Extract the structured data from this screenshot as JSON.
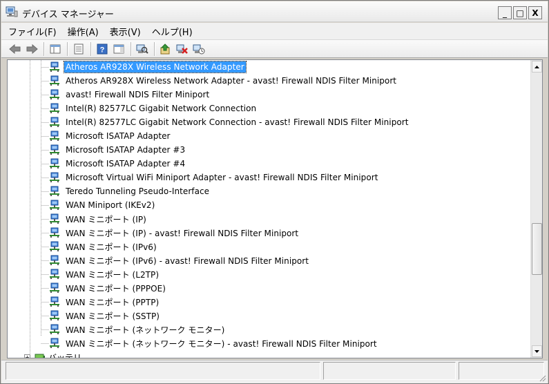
{
  "window": {
    "title": "デバイス マネージャー",
    "buttons": {
      "minimize": "_",
      "maximize": "□",
      "close": "X"
    }
  },
  "menu": {
    "items": [
      "ファイル(F)",
      "操作(A)",
      "表示(V)",
      "ヘルプ(H)"
    ]
  },
  "toolbar": {
    "icons": [
      "back-arrow-icon",
      "forward-arrow-icon",
      "console-tree-icon",
      "properties-icon",
      "help-icon",
      "action-pane-icon",
      "scan-hardware-icon",
      "update-driver-icon",
      "uninstall-icon",
      "disable-device-icon"
    ]
  },
  "tree": {
    "selected_index": 0,
    "items": [
      "Atheros AR928X Wireless Network Adapter",
      "Atheros AR928X Wireless Network Adapter - avast! Firewall NDIS Filter Miniport",
      "avast! Firewall NDIS Filter Miniport",
      "Intel(R) 82577LC Gigabit Network Connection",
      "Intel(R) 82577LC Gigabit Network Connection - avast! Firewall NDIS Filter Miniport",
      "Microsoft ISATAP Adapter",
      "Microsoft ISATAP Adapter #3",
      "Microsoft ISATAP Adapter #4",
      "Microsoft Virtual WiFi Miniport Adapter - avast! Firewall NDIS Filter Miniport",
      "Teredo Tunneling Pseudo-Interface",
      "WAN Miniport (IKEv2)",
      "WAN ミニポート (IP)",
      "WAN ミニポート (IP) - avast! Firewall NDIS Filter Miniport",
      "WAN ミニポート (IPv6)",
      "WAN ミニポート (IPv6) - avast! Firewall NDIS Filter Miniport",
      "WAN ミニポート (L2TP)",
      "WAN ミニポート (PPPOE)",
      "WAN ミニポート (PPTP)",
      "WAN ミニポート (SSTP)",
      "WAN ミニポート (ネットワーク モニター)",
      "WAN ミニポート (ネットワーク モニター) - avast! Firewall NDIS Filter Miniport"
    ],
    "next_category": "バッテリ"
  },
  "colors": {
    "selection": "#3399ff",
    "window_frame": "#d4d0c8",
    "tree_background": "#ffffff"
  }
}
